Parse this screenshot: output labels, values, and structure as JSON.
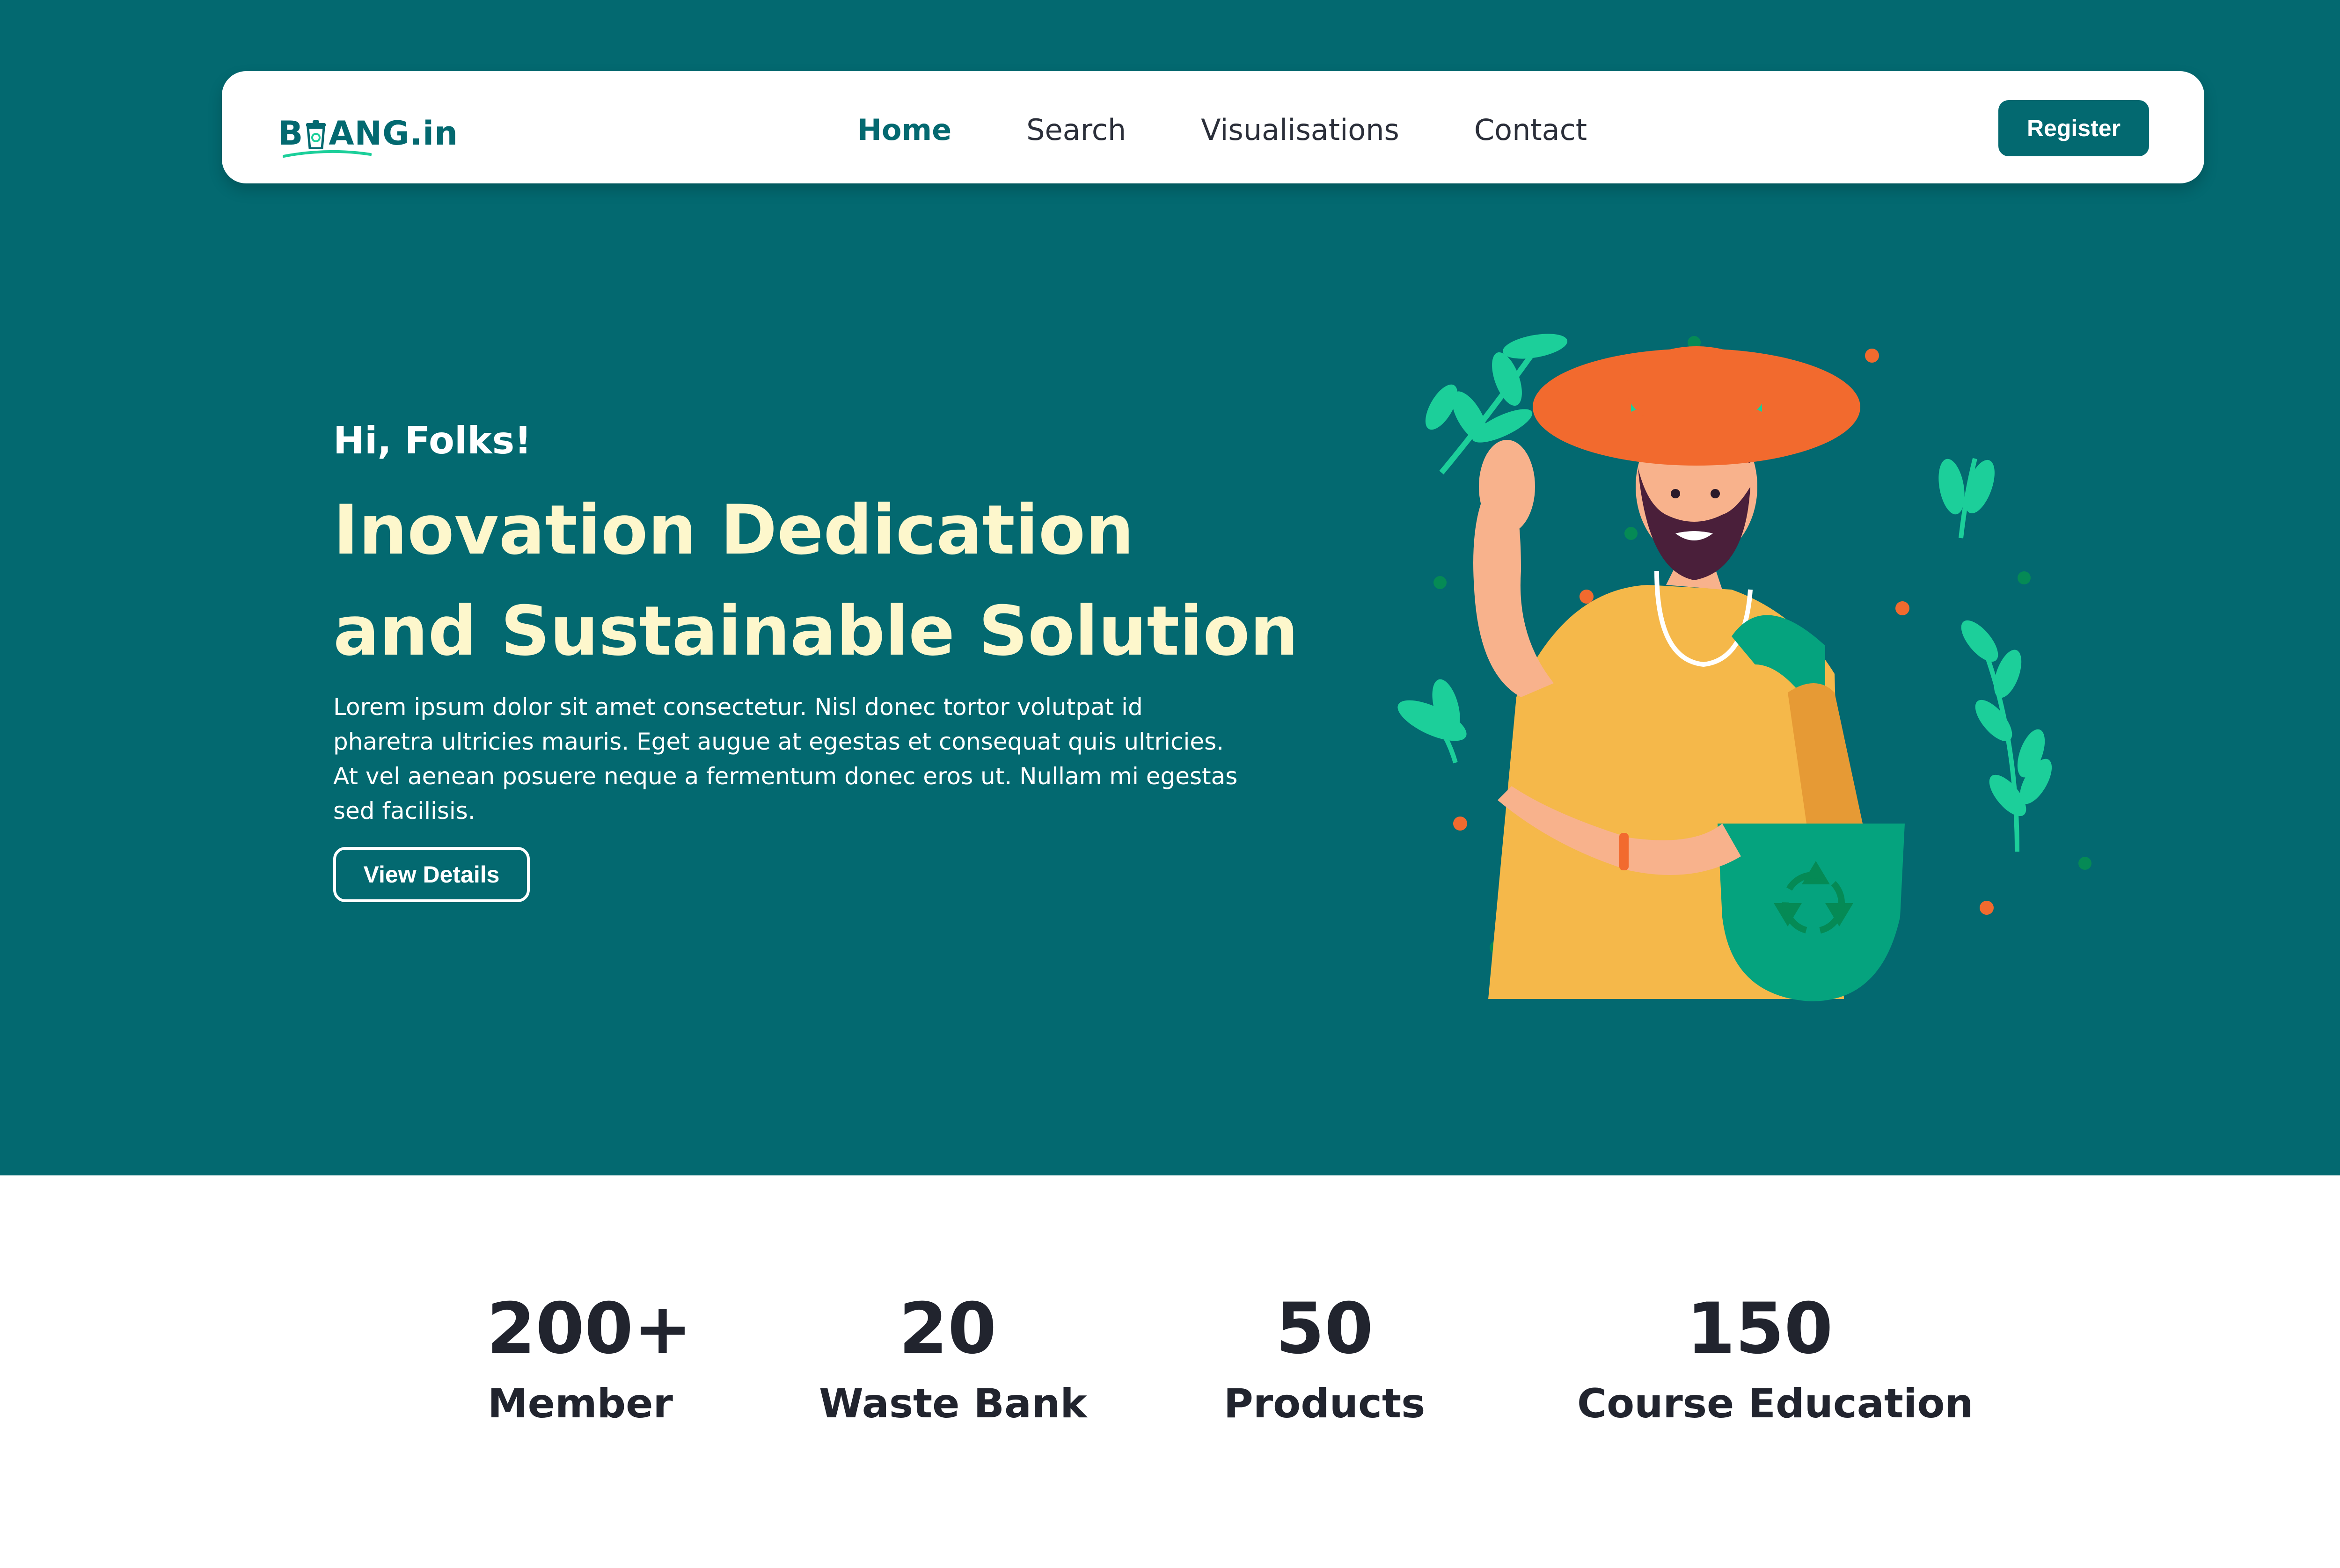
{
  "brand": {
    "logo_text_left": "B",
    "logo_text_right": "ANG.in"
  },
  "nav": {
    "links": [
      {
        "label": "Home",
        "active": true
      },
      {
        "label": "Search",
        "active": false
      },
      {
        "label": "Visualisations",
        "active": false
      },
      {
        "label": "Contact",
        "active": false
      }
    ],
    "register_label": "Register"
  },
  "hero": {
    "greeting": "Hi, Folks!",
    "headline_line1": "Inovation Dedication",
    "headline_line2": "and Sustainable Solution",
    "description": "Lorem ipsum dolor sit amet consectetur. Nisl donec tortor volutpat id pharetra ultricies mauris. Eget augue at egestas et consequat quis ultricies. At vel aenean posuere neque a fermentum donec eros ut. Nullam mi egestas sed facilisis.",
    "cta_label": "View Details"
  },
  "stats": [
    {
      "value": "200+",
      "label": "Member"
    },
    {
      "value": "20",
      "label": "Waste Bank"
    },
    {
      "value": "50",
      "label": "Products"
    },
    {
      "value": "150",
      "label": "Course Education"
    }
  ],
  "colors": {
    "primary": "#036970",
    "headline": "#fdf7cc",
    "hat": "#f26a2e",
    "shirt": "#f5b84a",
    "bag": "#05a37e",
    "leaf": "#1ccf9a",
    "text_dark": "#21242e"
  },
  "icons": [
    "recycle-icon",
    "leaf-icon",
    "waste-bin-icon"
  ]
}
